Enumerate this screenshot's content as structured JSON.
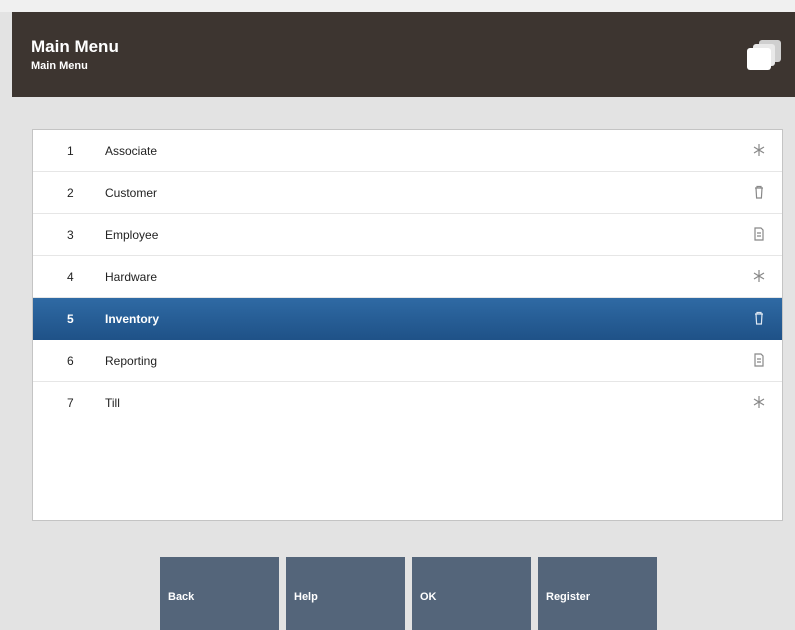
{
  "header": {
    "title": "Main Menu",
    "subtitle": "Main Menu",
    "icon": "stacked-papers-icon"
  },
  "menu": {
    "selected_index": 4,
    "items": [
      {
        "num": "1",
        "label": "Associate",
        "icon": "sparkle-icon"
      },
      {
        "num": "2",
        "label": "Customer",
        "icon": "trash-icon"
      },
      {
        "num": "3",
        "label": "Employee",
        "icon": "document-icon"
      },
      {
        "num": "4",
        "label": "Hardware",
        "icon": "sparkle-icon"
      },
      {
        "num": "5",
        "label": "Inventory",
        "icon": "trash-icon"
      },
      {
        "num": "6",
        "label": "Reporting",
        "icon": "document-icon"
      },
      {
        "num": "7",
        "label": "Till",
        "icon": "sparkle-icon"
      }
    ]
  },
  "buttons": {
    "back": "Back",
    "help": "Help",
    "ok": "OK",
    "register": "Register"
  },
  "colors": {
    "header_bg": "#3d3530",
    "selected_row": "#2a619a",
    "button_bg": "#54657a",
    "page_bg": "#e3e3e3"
  }
}
